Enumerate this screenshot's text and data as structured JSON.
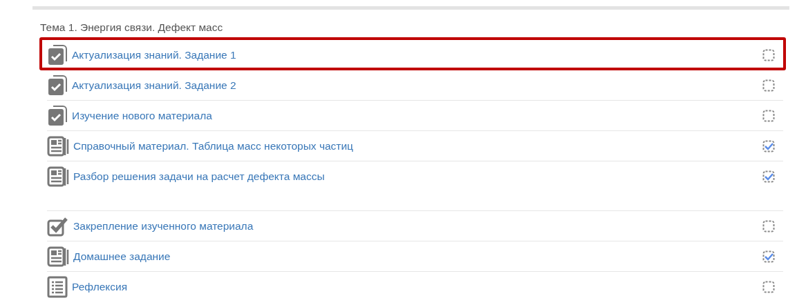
{
  "section": {
    "title": "Тема 1. Энергия связи. Дефект масс"
  },
  "groups": [
    {
      "activities": [
        {
          "kind": "quiz",
          "title": "Актуализация знаний. Задание 1",
          "highlighted": true,
          "checked": false
        },
        {
          "kind": "quiz",
          "title": "Актуализация знаний. Задание 2",
          "highlighted": false,
          "checked": false
        },
        {
          "kind": "quiz",
          "title": "Изучение нового материала",
          "highlighted": false,
          "checked": false
        },
        {
          "kind": "page",
          "title": "Справочный материал. Таблица масс некоторых частиц",
          "highlighted": false,
          "checked": true
        },
        {
          "kind": "page",
          "title": "Разбор решения задачи на расчет дефекта массы",
          "highlighted": false,
          "checked": true
        }
      ]
    },
    {
      "activities": [
        {
          "kind": "assign",
          "title": "Закрепление изученного материала",
          "highlighted": false,
          "checked": false
        },
        {
          "kind": "page",
          "title": "Домашнее задание",
          "highlighted": false,
          "checked": true
        },
        {
          "kind": "feedback",
          "title": "Рефлексия",
          "highlighted": false,
          "checked": false
        }
      ]
    }
  ]
}
